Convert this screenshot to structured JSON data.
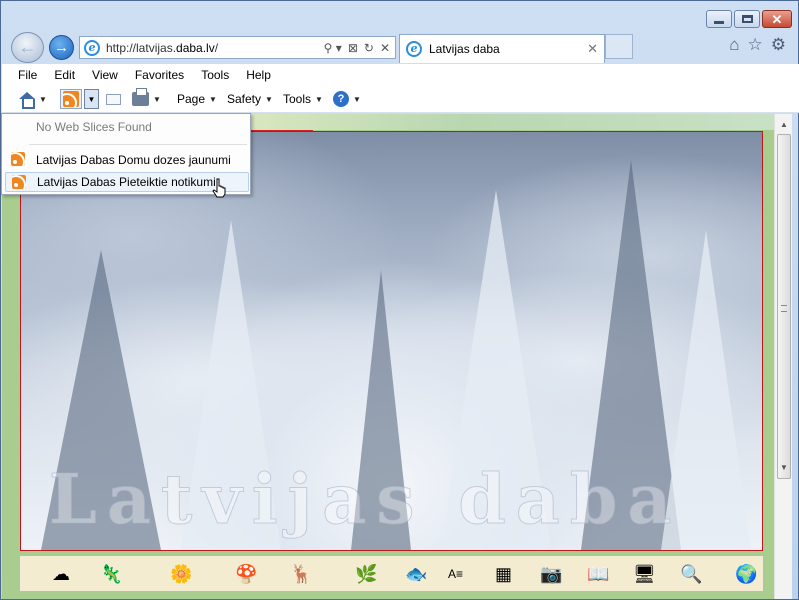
{
  "browser": {
    "address": {
      "prefix": "http://latvijas.",
      "domain": "daba.lv",
      "suffix": "/"
    },
    "tab": {
      "title": "Latvijas daba",
      "close": "✕"
    },
    "addr_icons": [
      "⚲ ▾",
      "⊠",
      "↻",
      "✕"
    ],
    "right_icons": {
      "home": "⌂",
      "favorites": "☆",
      "tools": "⚙"
    },
    "caption": {
      "close": "✕"
    }
  },
  "menubar": {
    "items": [
      "File",
      "Edit",
      "View",
      "Favorites",
      "Tools",
      "Help"
    ]
  },
  "commandbar": {
    "page": "Page",
    "safety": "Safety",
    "tools": "Tools",
    "help": "?"
  },
  "dropdown": {
    "no_slices": "No Web Slices Found",
    "feeds": [
      "Latvijas Dabas Domu dozes jaunumi",
      "Latvijas Dabas Pieteiktie notikumi"
    ]
  },
  "content": {
    "watermark": "Latvijas daba",
    "bottom_icons": [
      "☁",
      "🦎",
      "🌼",
      "🍄",
      "🦌",
      "🌿",
      "🐟",
      "A≡",
      "▦",
      "📷",
      "📖",
      "🖥",
      "🔍",
      "🌍"
    ]
  }
}
